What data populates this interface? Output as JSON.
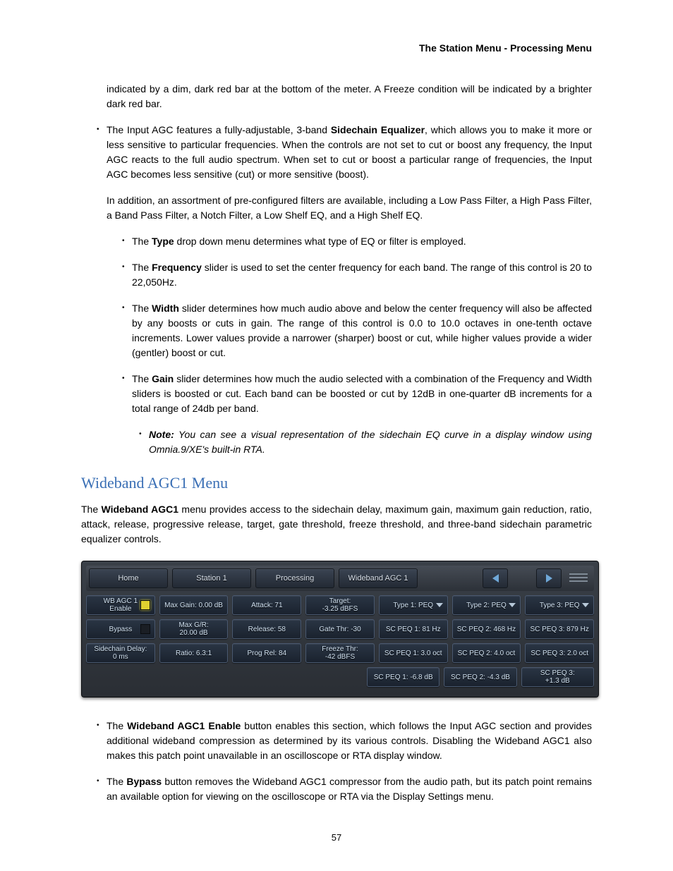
{
  "header": "The Station Menu - Processing Menu",
  "page_number": "57",
  "para_intro": "indicated by a dim, dark red bar at the bottom of the meter. A Freeze condition will be indicated by a brighter dark red bar.",
  "para_sidechain_pre": "The Input AGC features a fully-adjustable, 3-band ",
  "para_sidechain_bold": "Sidechain Equalizer",
  "para_sidechain_post": ", which allows you to make it more or less sensitive to particular frequencies. When the controls are not set to cut or boost any frequency, the Input AGC reacts to the full audio spectrum. When set to cut or boost a particular range of frequencies, the Input AGC becomes less sensitive (cut) or more sensitive (boost).",
  "para_filters": "In addition, an assortment of pre-configured filters are available, including a Low Pass Filter, a High Pass Filter, a Band Pass Filter, a Notch Filter, a Low Shelf EQ, and a High Shelf EQ.",
  "bullet_type_pre": "The ",
  "bullet_type_bold": "Type",
  "bullet_type_post": " drop down menu determines what type of EQ or filter is employed.",
  "bullet_freq_pre": "The ",
  "bullet_freq_bold": "Frequency",
  "bullet_freq_post": " slider is used to set the center frequency for each band. The range of this control is 20 to 22,050Hz.",
  "bullet_width_pre": "The ",
  "bullet_width_bold": "Width",
  "bullet_width_post": " slider determines how much audio above and below the center frequency will also be affected by any boosts or cuts in gain. The range of this control is 0.0 to 10.0 octaves in one-tenth octave increments. Lower values provide a narrower (sharper) boost or cut, while higher values provide a wider (gentler) boost or cut.",
  "bullet_gain_pre": "The ",
  "bullet_gain_bold": "Gain",
  "bullet_gain_post": " slider determines how much the audio selected with a combination of the Frequency and Width sliders is boosted or cut. Each band can be boosted or cut by 12dB in one-quarter dB increments for a total range of 24db per band.",
  "note_bold": "Note:",
  "note_text": " You can see a visual representation of the sidechain EQ curve in a display window using Omnia.9/XE's built-in RTA.",
  "section_heading": "Wideband AGC1 Menu",
  "section_intro_pre": "The ",
  "section_intro_bold": "Wideband AGC1",
  "section_intro_post": " menu provides access to the sidechain delay, maximum gain, maximum gain reduction, ratio, attack, release, progressive release, target, gate threshold, freeze threshold, and three-band sidechain parametric equalizer controls.",
  "bullet_enable_pre": "The ",
  "bullet_enable_bold": "Wideband AGC1 Enable",
  "bullet_enable_post": " button enables this section, which follows the Input AGC section and provides additional wideband compression as determined by its various controls. Disabling the Wideband AGC1 also makes this patch point unavailable in an oscilloscope or RTA display window.",
  "bullet_bypass_pre": "The ",
  "bullet_bypass_bold": "Bypass",
  "bullet_bypass_post": " button removes the Wideband AGC1 compressor from the audio path, but its patch point remains an available option for viewing on the oscilloscope or RTA via the Display Settings menu.",
  "ui": {
    "breadcrumb": [
      "Home",
      "Station 1",
      "Processing",
      "Wideband AGC 1"
    ],
    "row1": {
      "enable": "WB AGC 1\nEnable",
      "max_gain": "Max Gain: 0.00 dB",
      "attack": "Attack: 71",
      "target": "Target:\n-3.25 dBFS",
      "type1": "Type 1: PEQ",
      "type2": "Type 2: PEQ",
      "type3": "Type 3: PEQ"
    },
    "row2": {
      "bypass": "Bypass",
      "max_gr": "Max G/R:\n20.00 dB",
      "release": "Release: 58",
      "gate_thr": "Gate Thr: -30",
      "sc1": "SC PEQ 1: 81 Hz",
      "sc2": "SC PEQ 2: 468 Hz",
      "sc3": "SC PEQ 3: 879 Hz"
    },
    "row3": {
      "sidechain_delay": "Sidechain Delay:\n0 ms",
      "ratio": "Ratio: 6.3:1",
      "prog_rel": "Prog Rel: 84",
      "freeze_thr": "Freeze Thr:\n-42 dBFS",
      "sc1": "SC PEQ 1: 3.0 oct",
      "sc2": "SC PEQ 2: 4.0 oct",
      "sc3": "SC PEQ 3: 2.0 oct"
    },
    "row4": {
      "sc1": "SC PEQ 1: -6.8 dB",
      "sc2": "SC PEQ 2: -4.3 dB",
      "sc3": "SC PEQ 3:\n+1.3 dB"
    }
  }
}
